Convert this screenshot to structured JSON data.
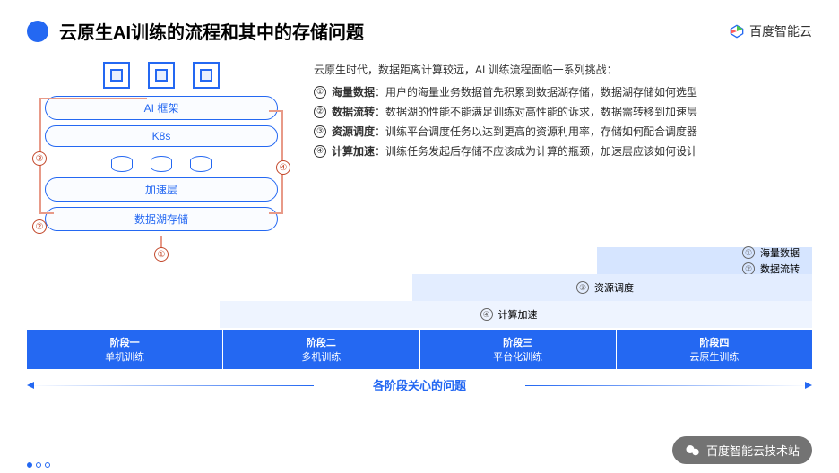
{
  "header": {
    "title": "云原生AI训练的流程和其中的存储问题",
    "brand": "百度智能云"
  },
  "diagram": {
    "layers": [
      "AI 框架",
      "K8s",
      "加速层",
      "数据湖存储"
    ],
    "numbers": [
      "①",
      "②",
      "③",
      "④"
    ]
  },
  "desc": {
    "intro": "云原生时代，数据距离计算较远，AI 训练流程面临一系列挑战：",
    "items": [
      {
        "num": "①",
        "label": "海量数据",
        "text": "：用户的海量业务数据首先积累到数据湖存储，数据湖存储如何选型"
      },
      {
        "num": "②",
        "label": "数据流转",
        "text": "：数据湖的性能不能满足训练对高性能的诉求，数据需转移到加速层"
      },
      {
        "num": "③",
        "label": "资源调度",
        "text": "：训练平台调度任务以达到更高的资源利用率，存储如何配合调度器"
      },
      {
        "num": "④",
        "label": "计算加速",
        "text": "：训练任务发起后存储不应该成为计算的瓶颈，加速层应该如何设计"
      }
    ]
  },
  "stairs": {
    "row1a": {
      "num": "①",
      "label": "海量数据"
    },
    "row1b": {
      "num": "②",
      "label": "数据流转"
    },
    "row2": {
      "num": "③",
      "label": "资源调度"
    },
    "row3": {
      "num": "④",
      "label": "计算加速"
    }
  },
  "phases": [
    {
      "title": "阶段一",
      "sub": "单机训练"
    },
    {
      "title": "阶段二",
      "sub": "多机训练"
    },
    {
      "title": "阶段三",
      "sub": "平台化训练"
    },
    {
      "title": "阶段四",
      "sub": "云原生训练"
    }
  ],
  "axis": "各阶段关心的问题",
  "wechat": "百度智能云技术站"
}
